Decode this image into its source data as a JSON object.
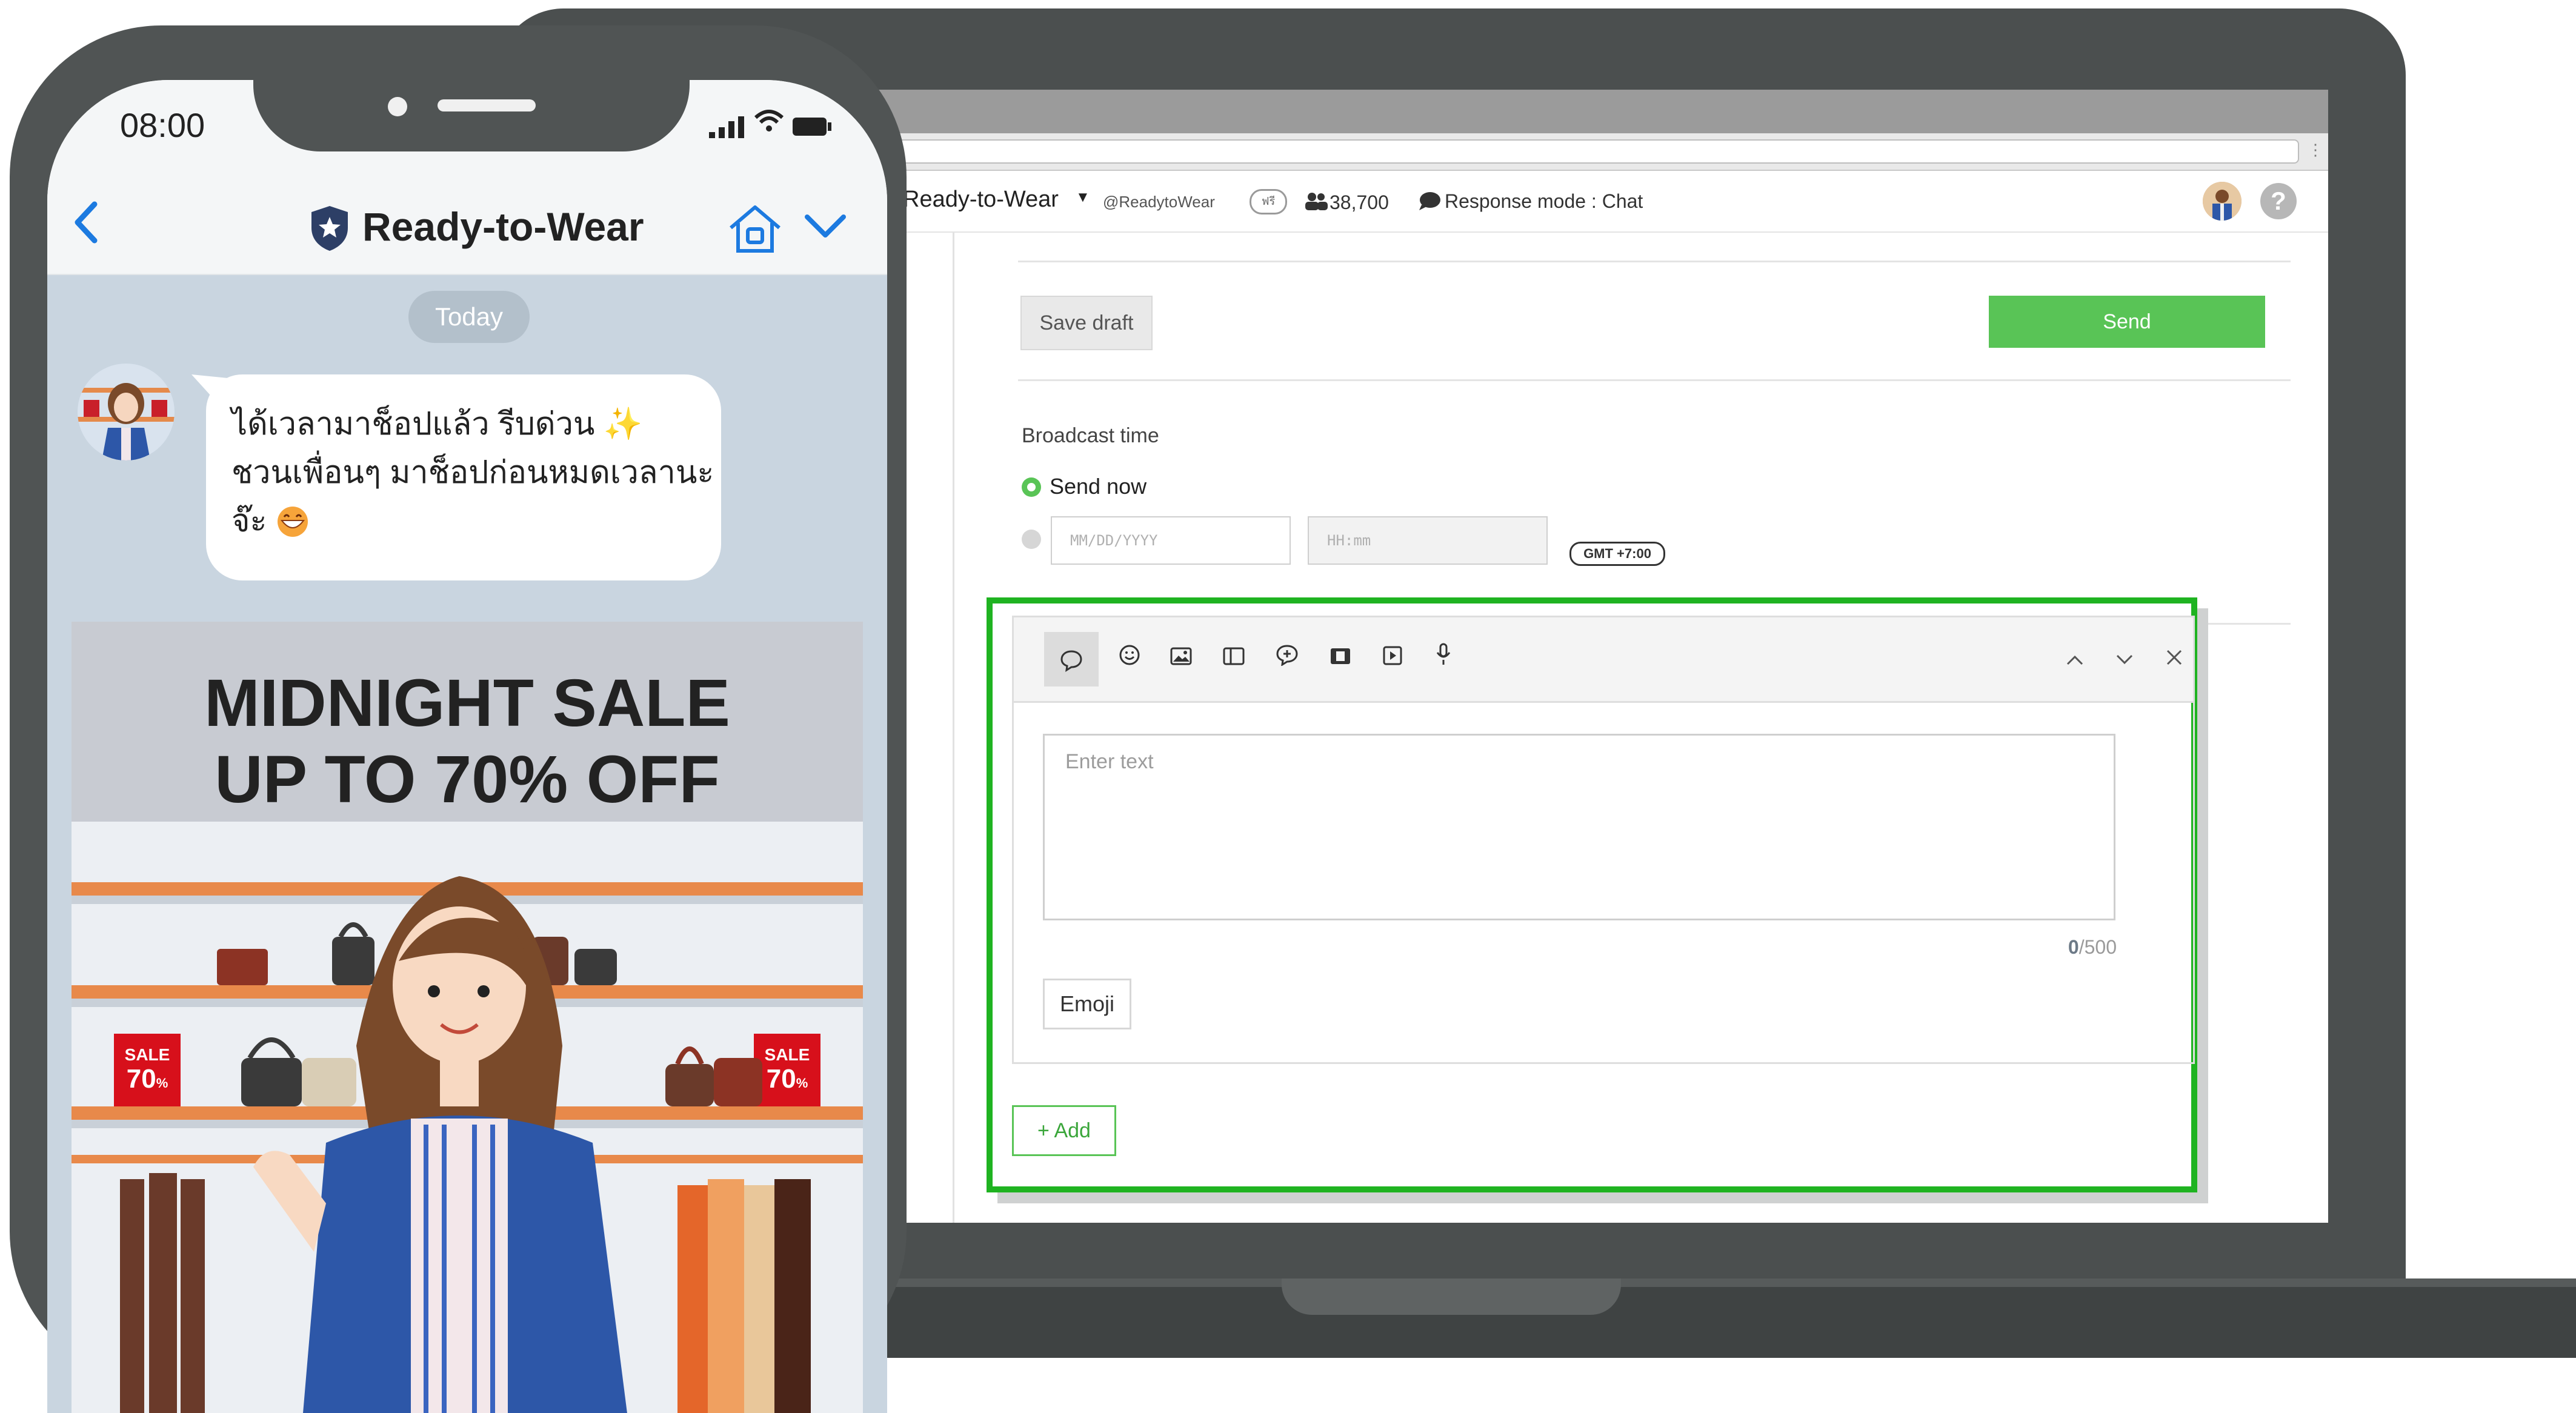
{
  "laptop": {
    "header": {
      "account_name": "Ready-to-Wear",
      "account_id": "@ReadytoWear",
      "account_badge": "ฟรี",
      "followers": "38,700",
      "response_mode": "Response mode : Chat"
    },
    "actions": {
      "save_draft_label": "Save draft",
      "send_label": "Send"
    },
    "broadcast": {
      "label": "Broadcast time",
      "send_now_label": "Send now",
      "date_placeholder": "MM/DD/YYYY",
      "time_placeholder": "HH:mm",
      "timezone": "GMT +7:00"
    },
    "editor": {
      "toolbar_icons": [
        "text-bubble-icon",
        "sticker-icon",
        "image-icon",
        "card-icon",
        "rich-message-icon",
        "video-icon",
        "play-icon",
        "audio-icon"
      ],
      "text_placeholder": "Enter text",
      "char_count": "0",
      "char_limit": "/500",
      "emoji_label": "Emoji",
      "add_label": "+ Add"
    }
  },
  "phone": {
    "status": {
      "time": "08:00"
    },
    "chat_title": "Ready-to-Wear",
    "date_separator": "Today",
    "message": {
      "line1": "ได้เวลามาช็อปแล้ว รีบด่วน",
      "line2": "ชวนเพื่อนๆ มาช็อปก่อนหมดเวลานะ",
      "line3": "จ๊ะ"
    },
    "banner": {
      "line1": "MIDNIGHT SALE",
      "line2": "UP TO 70% OFF",
      "tag_top": "SALE",
      "tag_value": "70",
      "tag_unit": "%"
    }
  },
  "colors": {
    "accent_green": "#59c456",
    "highlight_green": "#1fb321",
    "laptop_frame": "#4b4f4f",
    "link_blue": "#1c7ae0",
    "sale_red": "#d7101b"
  }
}
